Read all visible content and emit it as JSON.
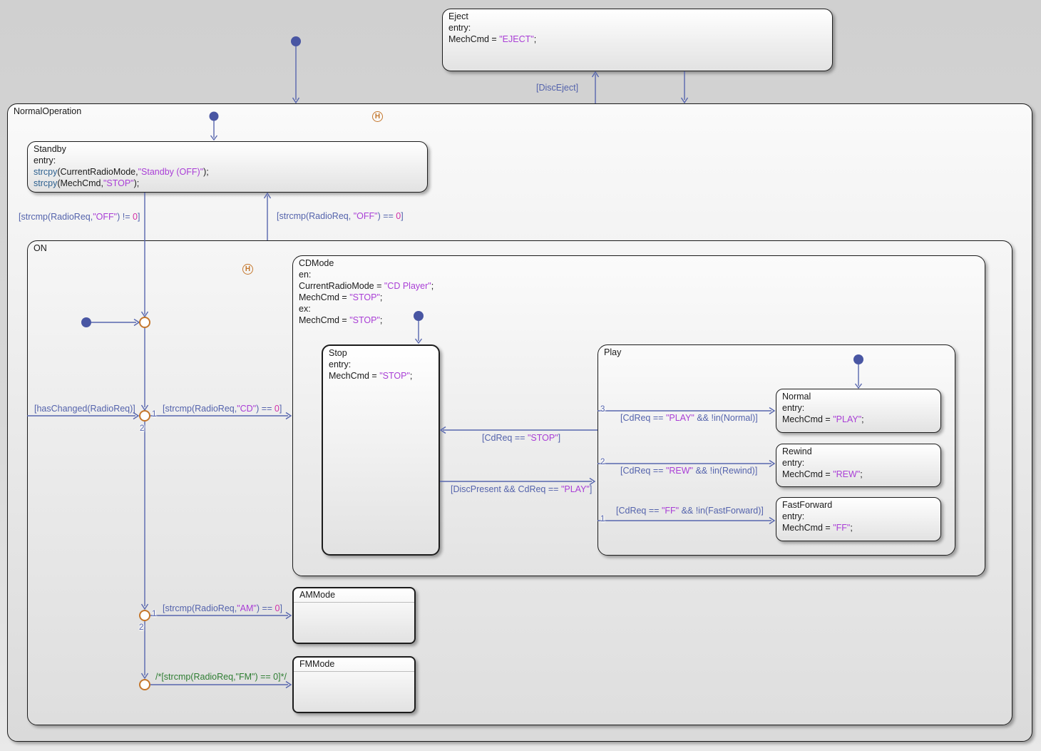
{
  "colors": {
    "transition": "#5463ac",
    "string": "#a93ed6",
    "number": "#d12fa6",
    "keyword": "#2d608f",
    "comment": "#2e7d32",
    "junction": "#c4762b",
    "state_border": "#1c1c1c",
    "default_dot": "#4956a3"
  },
  "states": {
    "normal_operation": {
      "title": "NormalOperation"
    },
    "on": {
      "title": "ON"
    },
    "eject": {
      "title": "Eject",
      "lines": [
        [
          {
            "t": "entry:",
            "c": "k"
          }
        ],
        [
          {
            "t": "MechCmd = ",
            "c": "k"
          },
          {
            "t": "\"EJECT\"",
            "c": "s"
          },
          {
            "t": ";",
            "c": "k"
          }
        ]
      ]
    },
    "standby": {
      "title": "Standby",
      "lines": [
        [
          {
            "t": "entry:",
            "c": "k"
          }
        ],
        [
          {
            "t": "strcpy",
            "c": "b"
          },
          {
            "t": "(CurrentRadioMode,",
            "c": "k"
          },
          {
            "t": "\"Standby (OFF)\"",
            "c": "s"
          },
          {
            "t": ");",
            "c": "k"
          }
        ],
        [
          {
            "t": "strcpy",
            "c": "b"
          },
          {
            "t": "(MechCmd,",
            "c": "k"
          },
          {
            "t": "\"STOP\"",
            "c": "s"
          },
          {
            "t": ");",
            "c": "k"
          }
        ]
      ]
    },
    "cdmode": {
      "title": "CDMode",
      "lines": [
        [
          {
            "t": "en:",
            "c": "k"
          }
        ],
        [
          {
            "t": "CurrentRadioMode = ",
            "c": "k"
          },
          {
            "t": "\"CD Player\"",
            "c": "s"
          },
          {
            "t": ";",
            "c": "k"
          }
        ],
        [
          {
            "t": "MechCmd = ",
            "c": "k"
          },
          {
            "t": "\"STOP\"",
            "c": "s"
          },
          {
            "t": ";",
            "c": "k"
          }
        ],
        [
          {
            "t": "ex:",
            "c": "k"
          }
        ],
        [
          {
            "t": "MechCmd = ",
            "c": "k"
          },
          {
            "t": "\"STOP\"",
            "c": "s"
          },
          {
            "t": ";",
            "c": "k"
          }
        ]
      ]
    },
    "stop": {
      "title": "Stop",
      "lines": [
        [
          {
            "t": "entry:",
            "c": "k"
          }
        ],
        [
          {
            "t": "MechCmd = ",
            "c": "k"
          },
          {
            "t": "\"STOP\"",
            "c": "s"
          },
          {
            "t": ";",
            "c": "k"
          }
        ]
      ]
    },
    "play": {
      "title": "Play"
    },
    "normal": {
      "title": "Normal",
      "lines": [
        [
          {
            "t": "entry:",
            "c": "k"
          }
        ],
        [
          {
            "t": "MechCmd = ",
            "c": "k"
          },
          {
            "t": "\"PLAY\"",
            "c": "s"
          },
          {
            "t": ";",
            "c": "k"
          }
        ]
      ]
    },
    "rewind": {
      "title": "Rewind",
      "lines": [
        [
          {
            "t": "entry:",
            "c": "k"
          }
        ],
        [
          {
            "t": "MechCmd = ",
            "c": "k"
          },
          {
            "t": "\"REW\"",
            "c": "s"
          },
          {
            "t": ";",
            "c": "k"
          }
        ]
      ]
    },
    "fastforward": {
      "title": "FastForward",
      "lines": [
        [
          {
            "t": "entry:",
            "c": "k"
          }
        ],
        [
          {
            "t": "MechCmd = ",
            "c": "k"
          },
          {
            "t": "\"FF\"",
            "c": "s"
          },
          {
            "t": ";",
            "c": "k"
          }
        ]
      ]
    },
    "ammode": {
      "title": "AMMode"
    },
    "fmmode": {
      "title": "FMMode"
    }
  },
  "transitions": {
    "disc_eject": [
      {
        "t": "[DiscEject]",
        "c": "t"
      }
    ],
    "radio_off_ne": [
      {
        "t": "[",
        "c": "t"
      },
      {
        "t": "strcmp",
        "c": "t"
      },
      {
        "t": "(RadioReq,",
        "c": "t"
      },
      {
        "t": "\"OFF\"",
        "c": "s"
      },
      {
        "t": ") != ",
        "c": "t"
      },
      {
        "t": "0",
        "c": "n"
      },
      {
        "t": "]",
        "c": "t"
      }
    ],
    "radio_off_eq": [
      {
        "t": "[",
        "c": "t"
      },
      {
        "t": "strcmp",
        "c": "t"
      },
      {
        "t": "(RadioReq, ",
        "c": "t"
      },
      {
        "t": "\"OFF\"",
        "c": "s"
      },
      {
        "t": ") == ",
        "c": "t"
      },
      {
        "t": "0",
        "c": "n"
      },
      {
        "t": "]",
        "c": "t"
      }
    ],
    "has_changed": [
      {
        "t": "[hasChanged(RadioReq)]",
        "c": "t"
      }
    ],
    "radio_cd": [
      {
        "t": "[strcmp(RadioReq,",
        "c": "t"
      },
      {
        "t": "\"CD\"",
        "c": "s"
      },
      {
        "t": ") == ",
        "c": "t"
      },
      {
        "t": "0",
        "c": "n"
      },
      {
        "t": "]",
        "c": "t"
      }
    ],
    "radio_am": [
      {
        "t": "[strcmp(RadioReq,",
        "c": "t"
      },
      {
        "t": "\"AM\"",
        "c": "s"
      },
      {
        "t": ") == ",
        "c": "t"
      },
      {
        "t": "0",
        "c": "n"
      },
      {
        "t": "]",
        "c": "t"
      }
    ],
    "radio_fm_comment": [
      {
        "t": "/*[strcmp(RadioReq,\"FM\") == 0]*/",
        "c": "g"
      }
    ],
    "cd_stop": [
      {
        "t": "[CdReq == ",
        "c": "t"
      },
      {
        "t": "\"STOP\"",
        "c": "s"
      },
      {
        "t": "]",
        "c": "t"
      }
    ],
    "disc_present_play": [
      {
        "t": "[DiscPresent && CdReq == ",
        "c": "t"
      },
      {
        "t": "\"PLAY\"",
        "c": "s"
      },
      {
        "t": "]",
        "c": "t"
      }
    ],
    "cd_play": [
      {
        "t": "[CdReq == ",
        "c": "t"
      },
      {
        "t": "\"PLAY\"",
        "c": "s"
      },
      {
        "t": " && !in(Normal)]",
        "c": "t"
      }
    ],
    "cd_rew": [
      {
        "t": "[CdReq == ",
        "c": "t"
      },
      {
        "t": "\"REW\"",
        "c": "s"
      },
      {
        "t": " && !in(Rewind)]",
        "c": "t"
      }
    ],
    "cd_ff": [
      {
        "t": "[CdReq == ",
        "c": "t"
      },
      {
        "t": "\"FF\"",
        "c": "s"
      },
      {
        "t": " && !in(FastForward)]",
        "c": "t"
      }
    ]
  },
  "junctions": {
    "history_label": "H",
    "radio_junction_order": [
      "1",
      "2"
    ],
    "band_junction_order": [
      "1",
      "2"
    ],
    "play_port_order": [
      "3",
      "2",
      "1"
    ]
  }
}
